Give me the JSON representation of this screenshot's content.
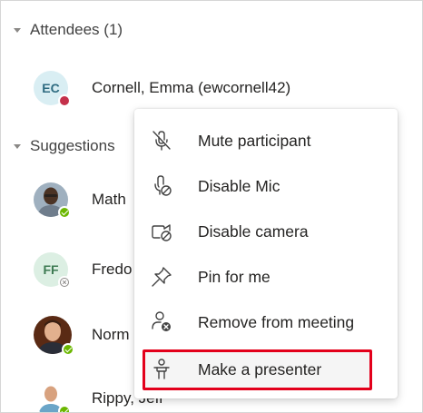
{
  "sections": {
    "attendees_label": "Attendees (1)",
    "suggestions_label": "Suggestions"
  },
  "attendees": [
    {
      "initials": "EC",
      "name": "Cornell, Emma (ewcornell42)",
      "status": "busy"
    }
  ],
  "suggestions": [
    {
      "initials": "",
      "name": "Math",
      "status": "available",
      "avatar": "photo"
    },
    {
      "initials": "FF",
      "name": "Fredo",
      "status": "offline",
      "avatar": "initials"
    },
    {
      "initials": "",
      "name": "Norm",
      "status": "available",
      "avatar": "photo"
    },
    {
      "initials": "",
      "name": "Rippy, Jeff",
      "status": "available",
      "avatar": "photo"
    }
  ],
  "context_menu": {
    "items": [
      {
        "label": "Mute participant",
        "icon": "mic-off-icon"
      },
      {
        "label": "Disable Mic",
        "icon": "mic-blocked-icon"
      },
      {
        "label": "Disable camera",
        "icon": "camera-blocked-icon"
      },
      {
        "label": "Pin for me",
        "icon": "pin-icon"
      },
      {
        "label": "Remove from meeting",
        "icon": "person-remove-icon"
      },
      {
        "label": "Make a presenter",
        "icon": "presenter-icon",
        "highlighted": true
      }
    ]
  },
  "colors": {
    "highlight_border": "#e3001b",
    "busy": "#c4314b",
    "available": "#6bb700",
    "icon_stroke": "#424242"
  }
}
